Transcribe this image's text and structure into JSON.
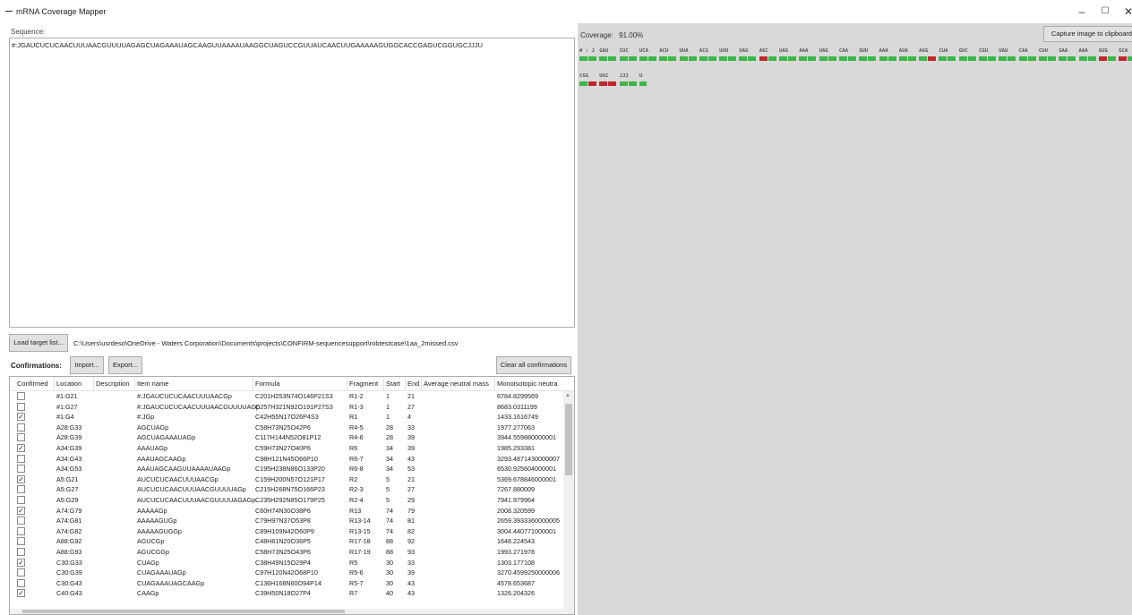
{
  "window": {
    "title": "mRNA Coverage Mapper",
    "minimize": "–",
    "maximize": "☐",
    "close": "✕"
  },
  "sequence": {
    "label": "Sequence:",
    "value": "#:JGAUCUCUCAACUUUAACGUUUUAGAGCUAGAAAUAGCAAGUUAAAAUAAGGCUAGUCCGUUAUCAACUUGAAAAAGUGGCACCGAGUCGGUGCJJJU"
  },
  "target": {
    "load_button": "Load target list...",
    "path": "C:\\Users\\usrdeso\\OneDrive - Waters Corporation\\Documents\\projects\\CONFIRM-sequencesupport\\robtestcase\\1aa_2missed.csv"
  },
  "confirmations": {
    "label": "Confirmations:",
    "import_button": "Import...",
    "export_button": "Export...",
    "clear_button": "Clear all confirmations"
  },
  "table": {
    "columns": [
      "Confirmed",
      "Location",
      "Description",
      "Item name",
      "Formula",
      "Fragment",
      "Start",
      "End",
      "Average neutral mass",
      "Monoisotopic neutra"
    ],
    "rows": [
      {
        "confirmed": false,
        "location": "#1:G21",
        "description": "",
        "item": "#:JGAUCUCUCAACUUUAACGp",
        "formula": "C201H253N74O146P21S3",
        "fragment": "R1-2",
        "start": "1",
        "end": "21",
        "avg": "",
        "mono": "6784.8299569"
      },
      {
        "confirmed": false,
        "location": "#1:G27",
        "description": "",
        "item": "#:JGAUCUCUCAACUUUAACGUUUUAGp",
        "formula": "C257H321N92O191P27S3",
        "fragment": "R1-3",
        "start": "1",
        "end": "27",
        "avg": "",
        "mono": "8683.0311199"
      },
      {
        "confirmed": true,
        "location": "#1:G4",
        "description": "",
        "item": "#:JGp",
        "formula": "C42H55N17O26P4S3",
        "fragment": "R1",
        "start": "1",
        "end": "4",
        "avg": "",
        "mono": "1433.1616749"
      },
      {
        "confirmed": false,
        "location": "A28:G33",
        "description": "",
        "item": "AGCUAGp",
        "formula": "C58H73N25O42P6",
        "fragment": "R4-5",
        "start": "28",
        "end": "33",
        "avg": "",
        "mono": "1977.277063"
      },
      {
        "confirmed": false,
        "location": "A28:G39",
        "description": "",
        "item": "AGCUAGAAAUAGp",
        "formula": "C117H144N52O81P12",
        "fragment": "R4-6",
        "start": "28",
        "end": "39",
        "avg": "",
        "mono": "3944.559880000001"
      },
      {
        "confirmed": true,
        "location": "A34:G39",
        "description": "",
        "item": "AAAUAGp",
        "formula": "C59H73N27O40P6",
        "fragment": "R6",
        "start": "34",
        "end": "39",
        "avg": "",
        "mono": "1985.293381"
      },
      {
        "confirmed": false,
        "location": "A34:G43",
        "description": "",
        "item": "AAAUAGCAAGp",
        "formula": "C98H121N45O66P10",
        "fragment": "R6-7",
        "start": "34",
        "end": "43",
        "avg": "",
        "mono": "3293.4871430000007"
      },
      {
        "confirmed": false,
        "location": "A34:G53",
        "description": "",
        "item": "AAAUAGCAAGUUAAAAUAAGp",
        "formula": "C195H238N86O133P20",
        "fragment": "R6-8",
        "start": "34",
        "end": "53",
        "avg": "",
        "mono": "6530.925604000001"
      },
      {
        "confirmed": true,
        "location": "A5:G21",
        "description": "",
        "item": "AUCUCUCAACUUUAACGp",
        "formula": "C159H200N57O121P17",
        "fragment": "R2",
        "start": "5",
        "end": "21",
        "avg": "",
        "mono": "5369.678846000001"
      },
      {
        "confirmed": false,
        "location": "A5:G27",
        "description": "",
        "item": "AUCUCUCAACUUUAACGUUUUAGp",
        "formula": "C215H268N75O166P23",
        "fragment": "R2-3",
        "start": "5",
        "end": "27",
        "avg": "",
        "mono": "7267.880009"
      },
      {
        "confirmed": false,
        "location": "A5:G29",
        "description": "",
        "item": "AUCUCUCAACUUUAACGUUUUAGAGp",
        "formula": "C235H292N85O179P25",
        "fragment": "R2-4",
        "start": "5",
        "end": "29",
        "avg": "",
        "mono": "7941.979964"
      },
      {
        "confirmed": true,
        "location": "A74:G79",
        "description": "",
        "item": "AAAAAGp",
        "formula": "C60H74N30O38P6",
        "fragment": "R13",
        "start": "74",
        "end": "79",
        "avg": "",
        "mono": "2008.320599"
      },
      {
        "confirmed": false,
        "location": "A74:G81",
        "description": "",
        "item": "AAAAAGUGp",
        "formula": "C79H97N37O53P8",
        "fragment": "R13-14",
        "start": "74",
        "end": "81",
        "avg": "",
        "mono": "2659.3933360000005"
      },
      {
        "confirmed": false,
        "location": "A74:G82",
        "description": "",
        "item": "AAAAAGUGGp",
        "formula": "C89H109N42O60P9",
        "fragment": "R13-15",
        "start": "74",
        "end": "82",
        "avg": "",
        "mono": "3004.440771000001"
      },
      {
        "confirmed": false,
        "location": "A88:G92",
        "description": "",
        "item": "AGUCGp",
        "formula": "C48H61N20O36P5",
        "fragment": "R17-18",
        "start": "88",
        "end": "92",
        "avg": "",
        "mono": "1648.224543"
      },
      {
        "confirmed": false,
        "location": "A88:G93",
        "description": "",
        "item": "AGUCGGp",
        "formula": "C58H73N25O43P6",
        "fragment": "R17-19",
        "start": "88",
        "end": "93",
        "avg": "",
        "mono": "1993.271978"
      },
      {
        "confirmed": true,
        "location": "C30:G33",
        "description": "",
        "item": "CUAGp",
        "formula": "C38H49N15O29P4",
        "fragment": "R5",
        "start": "30",
        "end": "33",
        "avg": "",
        "mono": "1303.177108"
      },
      {
        "confirmed": false,
        "location": "C30:G39",
        "description": "",
        "item": "CUAGAAAUAGp",
        "formula": "C97H120N42O68P10",
        "fragment": "R5-6",
        "start": "30",
        "end": "39",
        "avg": "",
        "mono": "3270.4599250000006"
      },
      {
        "confirmed": false,
        "location": "C30:G43",
        "description": "",
        "item": "CUAGAAAUAGCAAGp",
        "formula": "C136H168N60O94P14",
        "fragment": "R5-7",
        "start": "30",
        "end": "43",
        "avg": "",
        "mono": "4578.653687"
      },
      {
        "confirmed": true,
        "location": "C40:G43",
        "description": "",
        "item": "CAAGp",
        "formula": "C39H50N18O27P4",
        "fragment": "R7",
        "start": "40",
        "end": "43",
        "avg": "",
        "mono": "1326.204326"
      }
    ]
  },
  "coverage": {
    "label": "Coverage:",
    "value": "91.00%",
    "capture_button": "Capture image to clipboard",
    "colors": {
      "covered": "#3cb64a",
      "missed": "#c0272d"
    },
    "line1": [
      {
        "text": "# : J",
        "bars": [
          "g",
          "g"
        ]
      },
      {
        "text": "GAU",
        "bars": [
          "g",
          "g"
        ]
      },
      {
        "text": "CUC",
        "bars": [
          "g",
          "g"
        ]
      },
      {
        "text": "UCA",
        "bars": [
          "g",
          "g"
        ]
      },
      {
        "text": "ACU",
        "bars": [
          "g",
          "g"
        ]
      },
      {
        "text": "UUA",
        "bars": [
          "g",
          "g"
        ]
      },
      {
        "text": "ACG",
        "bars": [
          "g",
          "g"
        ]
      },
      {
        "text": "UUU",
        "bars": [
          "g",
          "g"
        ]
      },
      {
        "text": "UAG",
        "bars": [
          "g",
          "g"
        ]
      },
      {
        "text": "AGC",
        "bars": [
          "r",
          "g"
        ]
      },
      {
        "text": "UAG",
        "bars": [
          "g",
          "g"
        ]
      },
      {
        "text": "AAA",
        "bars": [
          "g",
          "g"
        ]
      },
      {
        "text": "UAG",
        "bars": [
          "g",
          "g"
        ]
      },
      {
        "text": "CAA",
        "bars": [
          "g",
          "g"
        ]
      },
      {
        "text": "GUU",
        "bars": [
          "g",
          "g"
        ]
      },
      {
        "text": "AAA",
        "bars": [
          "g",
          "g"
        ]
      },
      {
        "text": "AUA",
        "bars": [
          "g",
          "g"
        ]
      },
      {
        "text": "AGG",
        "bars": [
          "g",
          "r"
        ]
      },
      {
        "text": "CUA",
        "bars": [
          "g",
          "g"
        ]
      },
      {
        "text": "GUC",
        "bars": [
          "g",
          "g"
        ]
      },
      {
        "text": "CGU",
        "bars": [
          "g",
          "g"
        ]
      },
      {
        "text": "UAU",
        "bars": [
          "g",
          "g"
        ]
      },
      {
        "text": "CAA",
        "bars": [
          "g",
          "g"
        ]
      },
      {
        "text": "CUU",
        "bars": [
          "g",
          "g"
        ]
      },
      {
        "text": "GAA",
        "bars": [
          "g",
          "g"
        ]
      },
      {
        "text": "AAA",
        "bars": [
          "g",
          "g"
        ]
      },
      {
        "text": "GUG",
        "bars": [
          "r",
          "g"
        ]
      },
      {
        "text": "GCA",
        "bars": [
          "r",
          "g"
        ]
      },
      {
        "text": "CCG",
        "bars": [
          "g",
          "g"
        ]
      },
      {
        "text": "AGU",
        "bars": [
          "g",
          "g"
        ]
      }
    ],
    "line2": [
      {
        "text": "CGG",
        "bars": [
          "g",
          "r"
        ]
      },
      {
        "text": "UGC",
        "bars": [
          "r",
          "r"
        ]
      },
      {
        "text": "JJJ",
        "bars": [
          "g",
          "g"
        ]
      },
      {
        "text": "U",
        "bars": [
          "g"
        ]
      }
    ]
  }
}
